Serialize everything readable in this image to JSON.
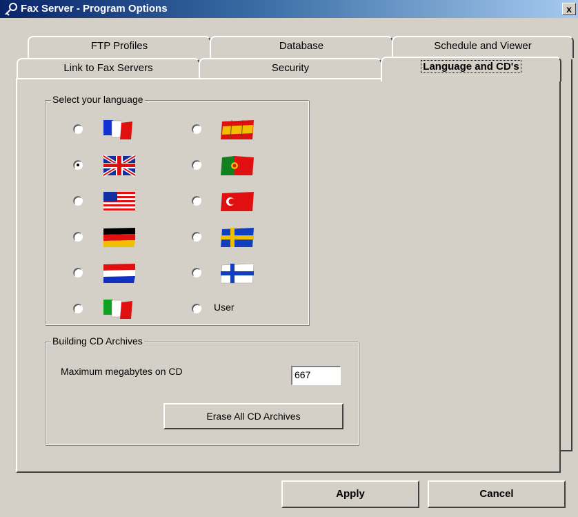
{
  "window": {
    "title": "Fax Server - Program Options",
    "close_label": "x"
  },
  "tabs_back": [
    "FTP Profiles",
    "Database",
    "Schedule and Viewer"
  ],
  "tabs_front": [
    "Link to Fax Servers",
    "Security",
    "Language and CD's"
  ],
  "active_tab": "Language and CD's",
  "language_group": {
    "title": "Select your language",
    "selected": "english-uk",
    "options": [
      {
        "id": "french",
        "icon": "flag-france-icon"
      },
      {
        "id": "spanish",
        "icon": "flag-spain-icon"
      },
      {
        "id": "english-uk",
        "icon": "flag-uk-icon"
      },
      {
        "id": "portuguese",
        "icon": "flag-portugal-icon"
      },
      {
        "id": "english-us",
        "icon": "flag-usa-icon"
      },
      {
        "id": "turkish",
        "icon": "flag-turkey-icon"
      },
      {
        "id": "german",
        "icon": "flag-germany-icon"
      },
      {
        "id": "swedish",
        "icon": "flag-sweden-icon"
      },
      {
        "id": "dutch",
        "icon": "flag-netherlands-icon"
      },
      {
        "id": "finnish",
        "icon": "flag-finland-icon"
      },
      {
        "id": "italian",
        "icon": "flag-italy-icon"
      },
      {
        "id": "user",
        "label": "User"
      }
    ]
  },
  "cd_group": {
    "title": "Building CD Archives",
    "max_mb_label": "Maximum megabytes on CD",
    "max_mb_value": "667",
    "erase_button": "Erase All CD Archives"
  },
  "buttons": {
    "apply": "Apply",
    "cancel": "Cancel"
  }
}
